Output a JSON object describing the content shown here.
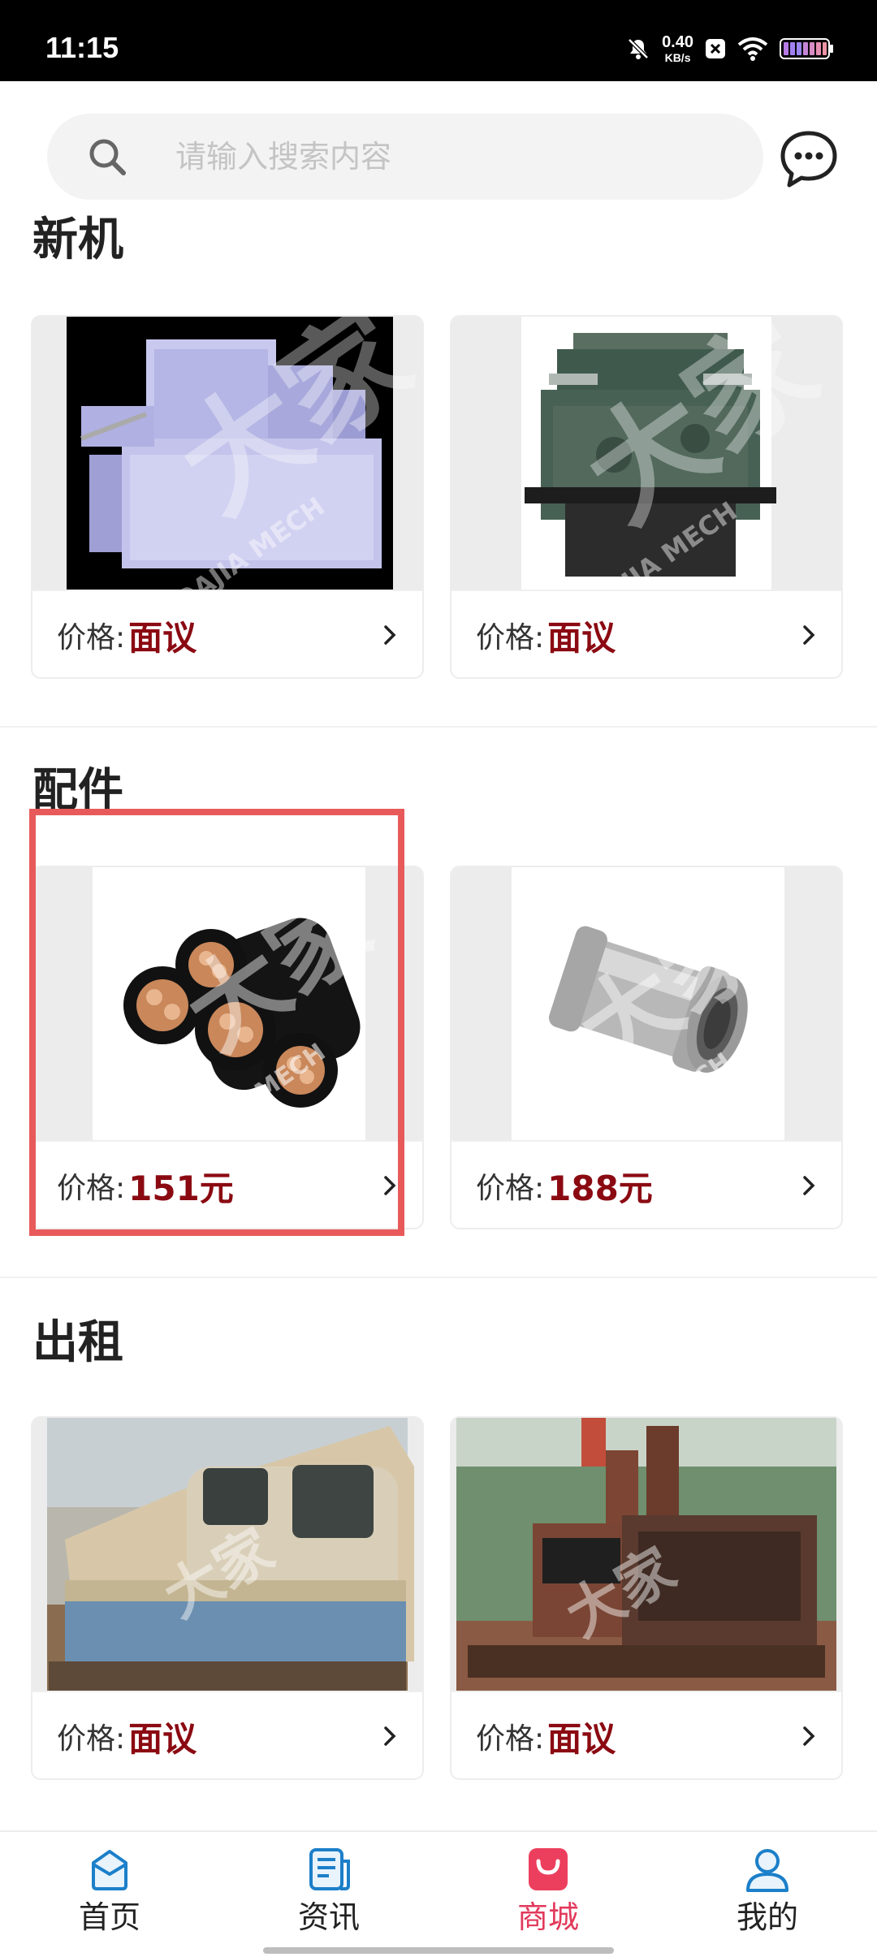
{
  "status_bar": {
    "time": "11:15",
    "speed_value": "0.40",
    "speed_unit": "KB/s",
    "icons": [
      "mute-bell-icon",
      "close-box-icon",
      "wifi-icon",
      "battery-icon"
    ]
  },
  "search": {
    "placeholder": "请输入搜索内容",
    "value": ""
  },
  "header": {
    "message_icon": "chat-bubble-icon"
  },
  "sections": {
    "new": {
      "title": "新机",
      "cards": [
        {
          "price_label": "价格:",
          "price_value": "面议",
          "image": "turbine-equipment"
        },
        {
          "price_label": "价格:",
          "price_value": "面议",
          "image": "green-gearbox-machine"
        }
      ]
    },
    "parts": {
      "title": "配件",
      "cards": [
        {
          "price_label": "价格:",
          "price_value": "151元",
          "image": "power-cable-bundle"
        },
        {
          "price_label": "价格:",
          "price_value": "188元",
          "image": "steel-check-valve"
        }
      ]
    },
    "rental": {
      "title": "出租",
      "cards": [
        {
          "price_label": "价格:",
          "price_value": "面议",
          "image": "mining-locomotive"
        },
        {
          "price_label": "价格:",
          "price_value": "面议",
          "image": "diesel-generator"
        }
      ]
    }
  },
  "watermark": {
    "brand": "DAJIA MECH"
  },
  "bottom_nav": {
    "items": [
      {
        "label": "首页",
        "icon": "home-icon",
        "active": false
      },
      {
        "label": "资讯",
        "icon": "news-icon",
        "active": false
      },
      {
        "label": "商城",
        "icon": "shop-bag-icon",
        "active": true
      },
      {
        "label": "我的",
        "icon": "user-icon",
        "active": false
      }
    ]
  },
  "colors": {
    "price": "#8b0a12",
    "active_nav": "#e2395b",
    "nav_icon_blue": "#1c7fc9",
    "highlight": "#e85a5a"
  }
}
